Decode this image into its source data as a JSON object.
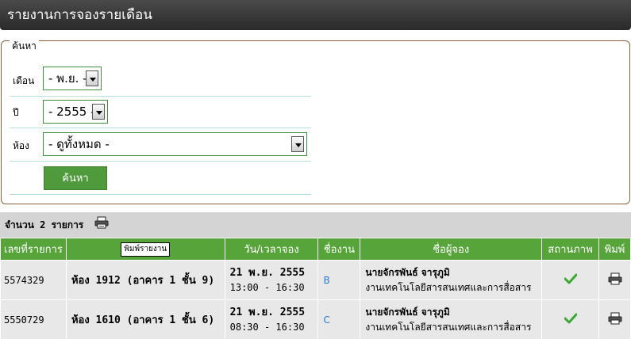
{
  "page": {
    "title": "รายงานการจองรายเดือน"
  },
  "search": {
    "legend": "ค้นหา",
    "month_label": "เดือน",
    "month_value": "- พ.ย. -",
    "year_label": "ปี",
    "year_value": "- 2555 -",
    "room_label": "ห้อง",
    "room_value": "- ดูทั้งหมด -",
    "button_label": "ค้นหา"
  },
  "summary": {
    "count_text": "จำนวน 2 รายการ",
    "print_icon": "printer-icon"
  },
  "table": {
    "headers": {
      "report_no": "เลขที่รายการ",
      "tooltip": "พิมพ์รายงาน",
      "datetime": "วัน/เวลาจอง",
      "work": "ชื่องาน",
      "booker": "ชื่อผู้จอง",
      "status": "สถานภาพ",
      "print": "พิมพ์"
    },
    "rows": [
      {
        "id": "5574329",
        "room": "ห้อง 1912 (อาคาร 1 ชั้น 9)",
        "date": "21 พ.ย. 2555",
        "time": "13:00 - 16:30",
        "work": "B",
        "name": "นายจักรพันธ์ จารุภูมิ",
        "unit": "งานเทคโนโลยีสารสนเทศและการสื่อสาร",
        "status_icon": "check-icon",
        "print_icon": "printer-icon"
      },
      {
        "id": "5550729",
        "room": "ห้อง 1610 (อาคาร 1 ชั้น 6)",
        "date": "21 พ.ย. 2555",
        "time": "08:30 - 16:30",
        "work": "C",
        "name": "นายจักรพันธ์ จารุภูมิ",
        "unit": "งานเทคโนโลยีสารสนเทศและการสื่อสาร",
        "status_icon": "check-icon",
        "print_icon": "printer-icon"
      }
    ]
  },
  "colors": {
    "header_green": "#57a43a",
    "titlebar": "#333333",
    "link_blue": "#2a78d2",
    "check_green": "#3aa832"
  }
}
